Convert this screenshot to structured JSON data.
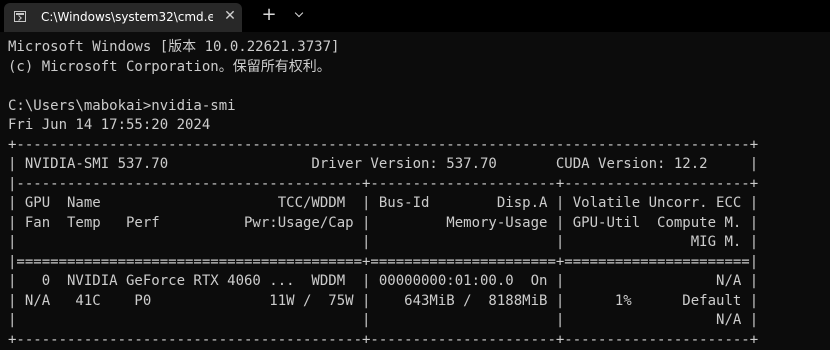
{
  "window": {
    "tab_title": "C:\\Windows\\system32\\cmd.e:",
    "tab_close_glyph": "✕",
    "new_tab_glyph": "+",
    "icon": "cmd-icon"
  },
  "console": {
    "lines": [
      "Microsoft Windows [版本 10.0.22621.3737]",
      "(c) Microsoft Corporation。保留所有权利。",
      "",
      "C:\\Users\\mabokai>nvidia-smi",
      "Fri Jun 14 17:55:20 2024",
      "+---------------------------------------------------------------------------------------+",
      "| NVIDIA-SMI 537.70                 Driver Version: 537.70       CUDA Version: 12.2     |",
      "|-----------------------------------------+----------------------+----------------------+",
      "| GPU  Name                     TCC/WDDM  | Bus-Id        Disp.A | Volatile Uncorr. ECC |",
      "| Fan  Temp   Perf          Pwr:Usage/Cap |         Memory-Usage | GPU-Util  Compute M. |",
      "|                                         |                      |               MIG M. |",
      "|=========================================+======================+======================|",
      "|   0  NVIDIA GeForce RTX 4060 ...  WDDM  | 00000000:01:00.0  On |                  N/A |",
      "| N/A   41C    P0              11W /  75W |    643MiB /  8188MiB |      1%      Default |",
      "|                                         |                      |                  N/A |",
      "+-----------------------------------------+----------------------+----------------------+"
    ]
  }
}
